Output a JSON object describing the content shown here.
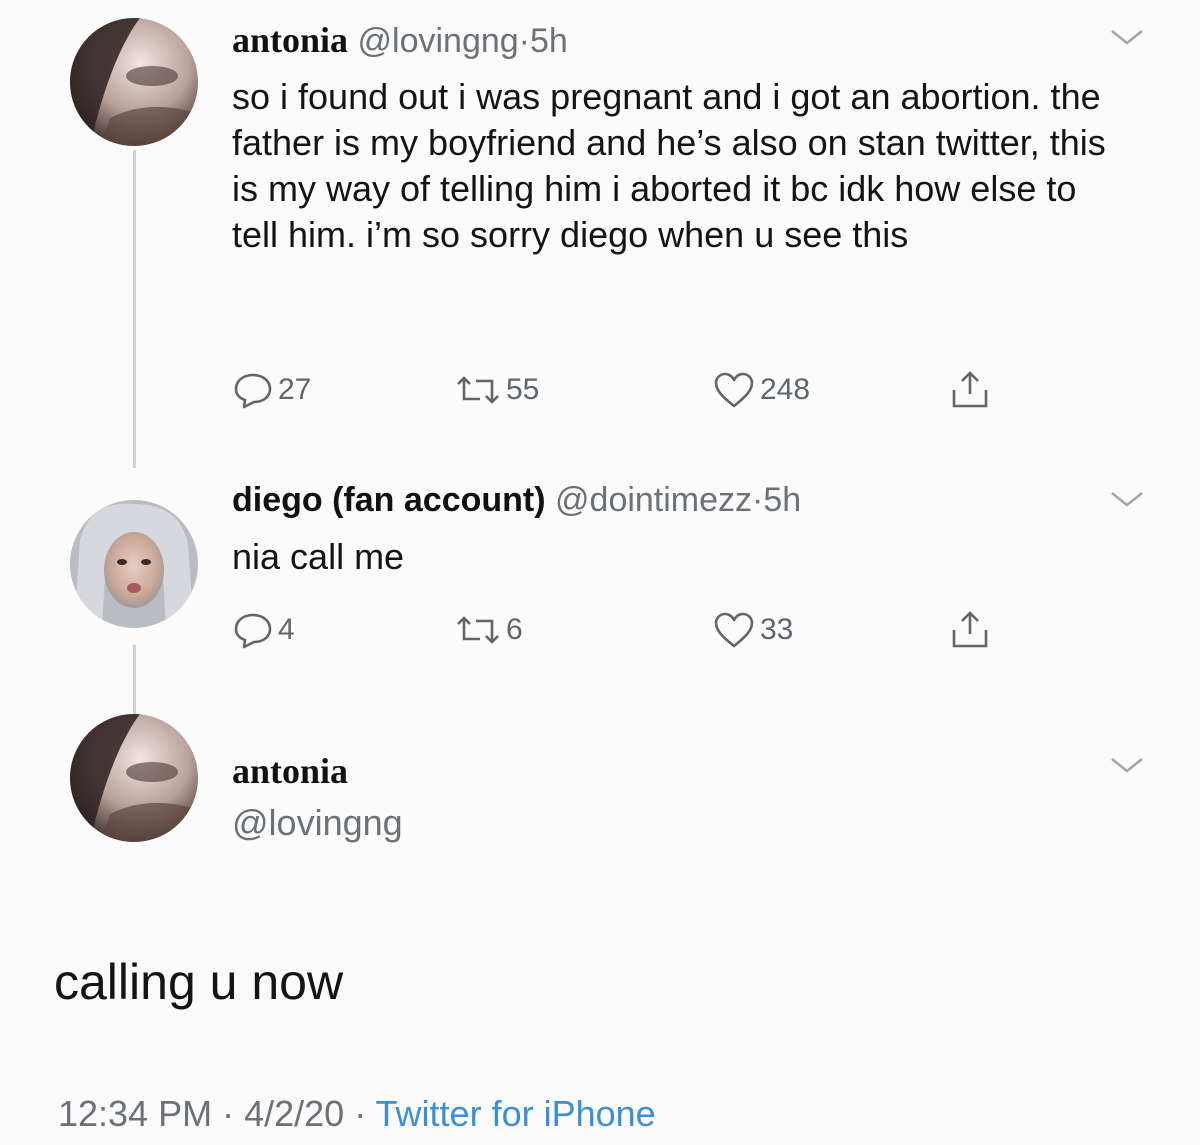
{
  "tweets": [
    {
      "name": "antonia",
      "handle": "@lovingng",
      "time": "5h",
      "text": "so i found out i was pregnant and i got an abortion. the father is my boyfriend and he’s also on stan twitter, this is my way of telling him i aborted it bc idk how else to tell him. i’m so sorry diego when u see this",
      "replies": "27",
      "retweets": "55",
      "likes": "248"
    },
    {
      "name": "diego (fan account)",
      "handle": "@dointimezz",
      "time": "5h",
      "text": "nia call me",
      "replies": "4",
      "retweets": "6",
      "likes": "33"
    }
  ],
  "focused_tweet": {
    "name": "antonia",
    "handle": "@lovingng",
    "text": "calling u now",
    "timestamp": "12:34 PM · 4/2/20",
    "separator": "·",
    "source": "Twitter for iPhone"
  },
  "separator": "·",
  "icons": {
    "reply": "reply-icon",
    "retweet": "retweet-icon",
    "like": "heart-icon",
    "share": "share-icon",
    "menu": "chevron-down-icon"
  },
  "colors": {
    "text": "#141414",
    "muted": "#6b7177",
    "link": "#3b8fd6",
    "thread_line": "#cfd4d8"
  }
}
